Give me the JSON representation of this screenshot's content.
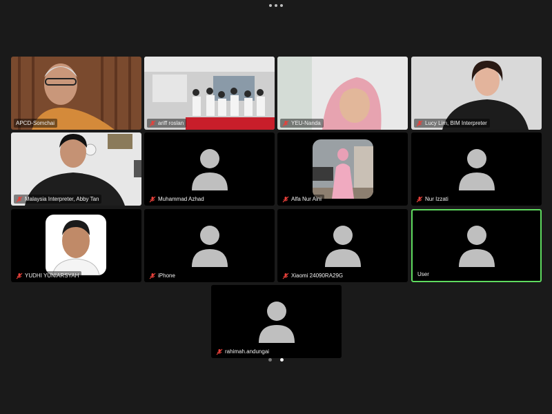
{
  "participants": [
    {
      "name": "APCD-Somchai",
      "muted": false
    },
    {
      "name": "ariff roslan",
      "muted": true
    },
    {
      "name": "YEU-Nanda",
      "muted": true
    },
    {
      "name": "Lucy Lim, BIM Interpreter",
      "muted": true
    },
    {
      "name": "Malaysia Interpreter, Abby Tan",
      "muted": true
    },
    {
      "name": "Muhammad Azhad",
      "muted": true
    },
    {
      "name": "Alfa Nur Aini",
      "muted": true
    },
    {
      "name": "Nur Izzati",
      "muted": true
    },
    {
      "name": "YUDHI YUNIARSYAH",
      "muted": true
    },
    {
      "name": "iPhone",
      "muted": true
    },
    {
      "name": "Xiaomi 24090RA29G",
      "muted": true
    },
    {
      "name": "User",
      "muted": false
    },
    {
      "name": "rahimah.andungai",
      "muted": true
    }
  ],
  "colors": {
    "active_speaker_border": "#5fdc5f",
    "muted_icon": "#e8403a",
    "avatar": "#bfbfbf"
  },
  "pagination": {
    "current_page": 2,
    "total_pages": 2
  }
}
